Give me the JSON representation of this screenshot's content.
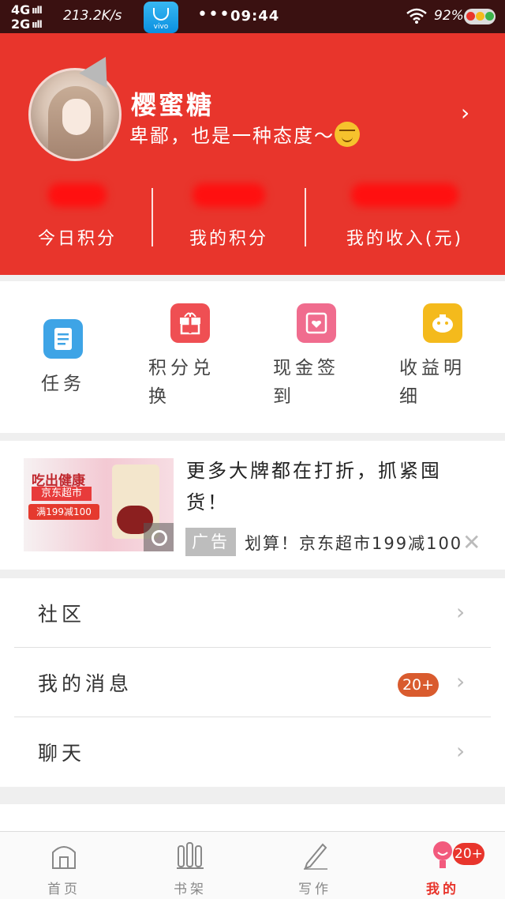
{
  "status_bar": {
    "network_top": "4G",
    "network_bottom": "2G",
    "signal_bars": "ııll",
    "speed": "213.2K/s",
    "launcher_brand": "vivo",
    "dots": "•••",
    "time": "09:44",
    "battery": "92%"
  },
  "profile": {
    "nickname": "樱蜜糖",
    "signature": "卑鄙，也是一种态度～",
    "stats": [
      {
        "label": "今日积分"
      },
      {
        "label": "我的积分"
      },
      {
        "label": "我的收入(元)"
      }
    ]
  },
  "quick_menu": [
    {
      "label": "任务",
      "icon": "task-icon",
      "color": "#3ea4e6"
    },
    {
      "label": "积分兑换",
      "label_line1": "积分兑",
      "label_line2": "换",
      "icon": "gift-icon",
      "color": "#ef4f53"
    },
    {
      "label": "现金签到",
      "label_line1": "现金签",
      "label_line2": "到",
      "icon": "checkin-icon",
      "color": "#f06c8e"
    },
    {
      "label": "收益明细",
      "label_line1": "收益明",
      "label_line2": "细",
      "icon": "piggybank-icon",
      "color": "#f4ba1c"
    }
  ],
  "ad": {
    "title": "更多大牌都在打折，抓紧囤货！",
    "badge": "广告",
    "description": "划算！京东超市199减100",
    "image_text": {
      "logo": "京东超市",
      "slogan": "吃出健康",
      "deal": "满199减100"
    }
  },
  "menu_list": [
    {
      "label": "社区"
    },
    {
      "label": "我的消息",
      "badge": "20+"
    },
    {
      "label": "聊天"
    }
  ],
  "tabbar": {
    "tabs": [
      {
        "label": "首页",
        "icon": "home-icon"
      },
      {
        "label": "书架",
        "icon": "bookshelf-icon"
      },
      {
        "label": "写作",
        "icon": "pen-icon"
      },
      {
        "label": "我的",
        "icon": "profile-icon",
        "active": true
      }
    ],
    "badge": "20+"
  },
  "colors": {
    "brand_red": "#e8352c",
    "status_bar": "#3a1111"
  }
}
